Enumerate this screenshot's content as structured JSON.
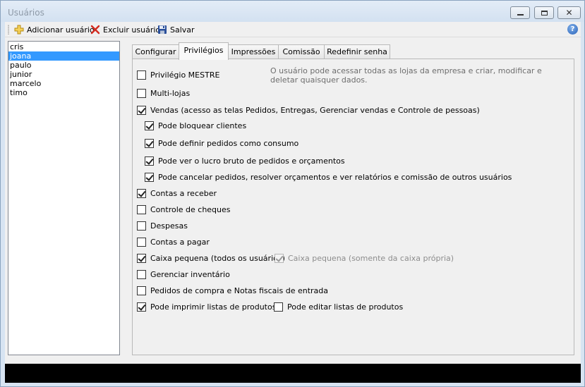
{
  "window": {
    "title": "Usuários"
  },
  "toolbar": {
    "add_user": "Adicionar usuário",
    "delete_user": "Excluir usuário",
    "save": "Salvar"
  },
  "users": [
    "cris",
    "joana",
    "paulo",
    "junior",
    "marcelo",
    "timo"
  ],
  "selected_user": "joana",
  "tabs": [
    "Configurar",
    "Privilégios",
    "Impressões",
    "Comissão",
    "Redefinir senha"
  ],
  "active_tab": "Privilégios",
  "privileges": {
    "mestre": {
      "label": "Privilégio MESTRE",
      "checked": false
    },
    "mestre_desc": "O usuário pode acessar todas as lojas da empresa e criar, modificar e deletar quaisquer dados.",
    "multilojas": {
      "label": "Multi-lojas",
      "checked": false
    },
    "vendas": {
      "label": "Vendas (acesso as telas Pedidos, Entregas, Gerenciar vendas e Controle de pessoas)",
      "checked": true
    },
    "bloquear_clientes": {
      "label": "Pode bloquear clientes",
      "checked": true
    },
    "pedidos_consumo": {
      "label": "Pode definir pedidos como consumo",
      "checked": true
    },
    "lucro_bruto": {
      "label": "Pode ver o lucro bruto de pedidos e orçamentos",
      "checked": true
    },
    "cancelar_pedidos": {
      "label": "Pode cancelar pedidos, resolver orçamentos e ver relatórios e comissão de outros usuários",
      "checked": true
    },
    "contas_receber": {
      "label": "Contas a receber",
      "checked": true
    },
    "controle_cheques": {
      "label": "Controle de cheques",
      "checked": false
    },
    "despesas": {
      "label": "Despesas",
      "checked": false
    },
    "contas_pagar": {
      "label": "Contas a pagar",
      "checked": false
    },
    "caixa_todos": {
      "label": "Caixa pequena (todos os usuários)",
      "checked": true
    },
    "caixa_propria": {
      "label": "Caixa pequena (somente da caixa própria)",
      "checked": true,
      "disabled": true
    },
    "inventario": {
      "label": "Gerenciar inventário",
      "checked": false
    },
    "pedidos_compra": {
      "label": "Pedidos de compra e Notas fiscais de entrada",
      "checked": false
    },
    "imprimir_listas": {
      "label": "Pode imprimir listas de produtos",
      "checked": true
    },
    "editar_listas": {
      "label": "Pode editar listas de produtos",
      "checked": false
    }
  },
  "colors": {
    "selection": "#3399ff",
    "status_bar": "#000000"
  }
}
